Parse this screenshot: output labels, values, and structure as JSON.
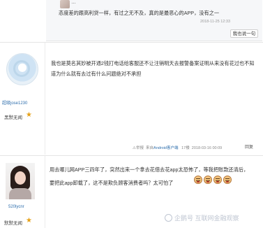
{
  "post1": {
    "line1": "…",
    "line2": "态度差的跟高利贷一样，有过之无不及，真的是最恶心的APP，没有之一",
    "time": "2018-11-25 12:33",
    "reply_button": "我也说一句"
  },
  "post2": {
    "username": "超级jose1230",
    "level_label": "黑默无闻",
    "line1": "我也是莫名其妙被开通2钱打电话给客服还不让注销明天去报警备案证明从来没有花过也不知",
    "line2": "道为什么就有去过有什么问题绝对不承担",
    "report_label": "举报",
    "from_label": "来自",
    "client_link": "Android客户端",
    "floor": "17楼",
    "time": "2018-03-16 00:09",
    "reply_label": "回复"
  },
  "post3": {
    "username": "520lycnr",
    "level_label": "默默无闻",
    "line1": "用去哪儿网APP三四年了，突然出来一个拿去花借去花app太恐怖了，等我把账款还清后，",
    "line2": "要把此app卸载了，这不是欺负顾客消费者吗？太可怕了"
  },
  "watermark": {
    "text": "企鹅号 互联网金融观察"
  },
  "colors": {
    "link": "#2f6fad",
    "level_star": "#e6a117",
    "watermark": "#bfc6d2"
  }
}
